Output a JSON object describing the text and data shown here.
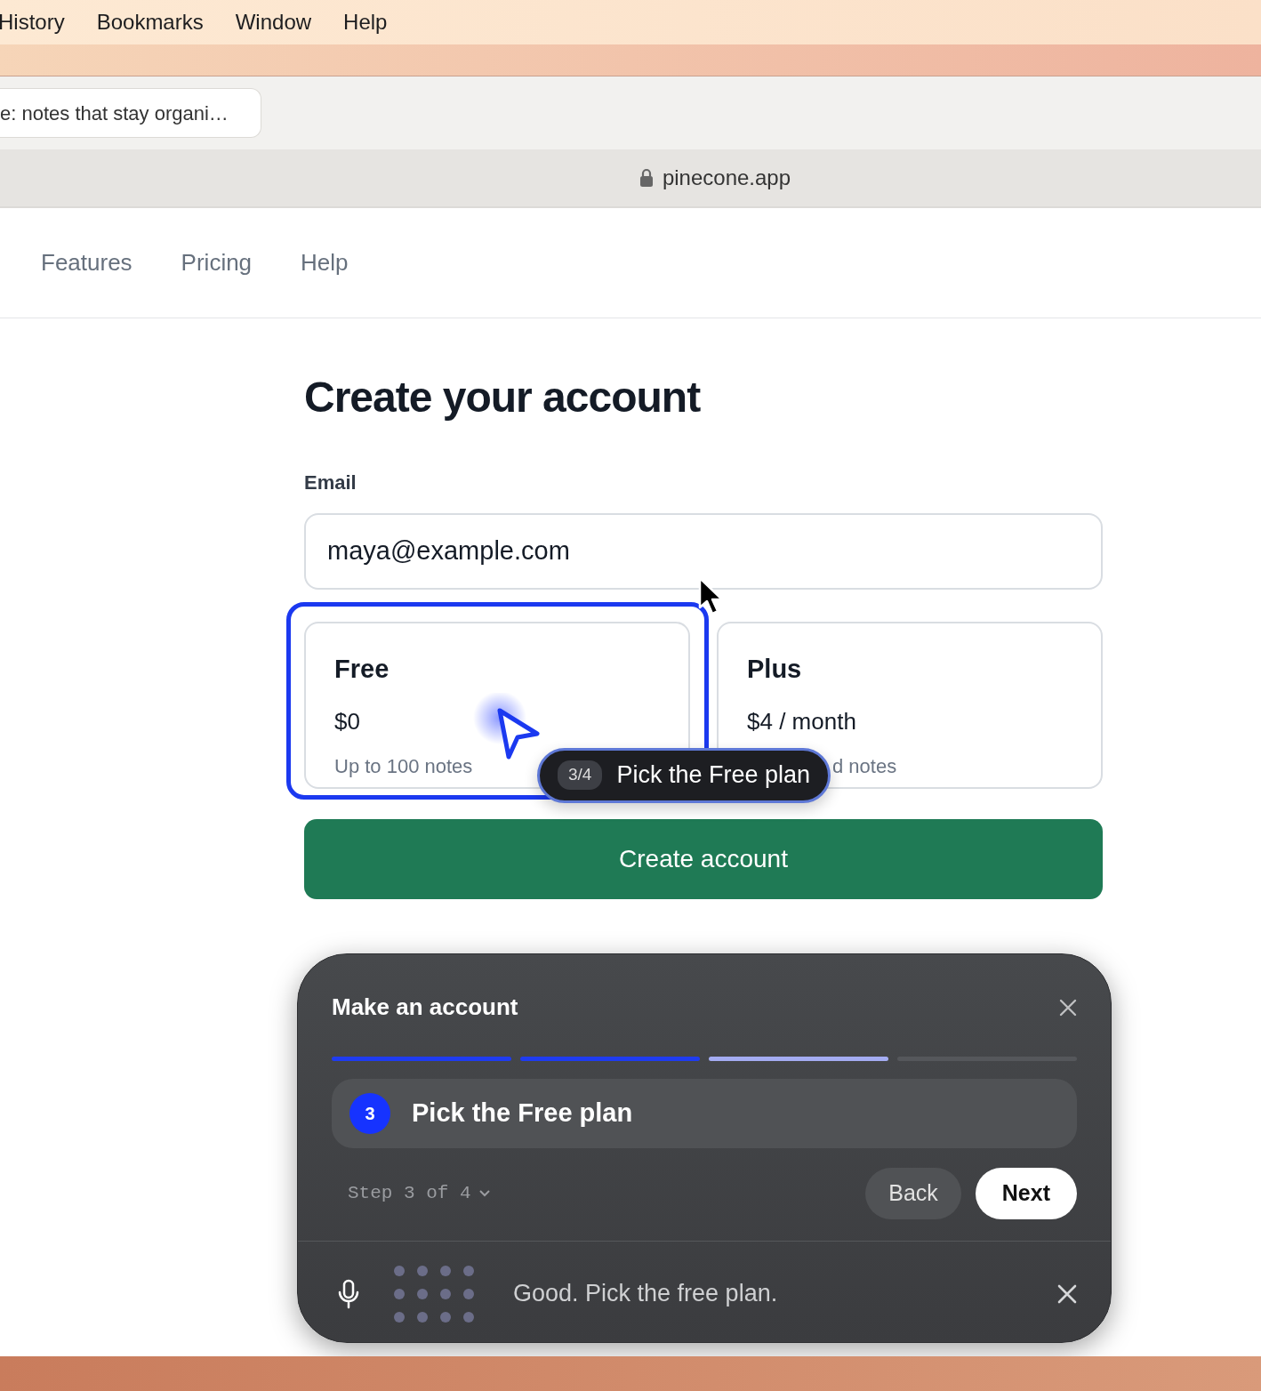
{
  "menu_bar": {
    "items": [
      "History",
      "Bookmarks",
      "Window",
      "Help"
    ]
  },
  "browser": {
    "tab_title": "e: notes that stay organi…",
    "address": "pinecone.app",
    "secure": true
  },
  "site_nav": {
    "links": [
      "Features",
      "Pricing",
      "Help"
    ]
  },
  "form": {
    "title": "Create your account",
    "email_label": "Email",
    "email_value": "maya@example.com",
    "plans": [
      {
        "name": "Free",
        "price": "$0",
        "description": "Up to 100 notes",
        "highlighted": true
      },
      {
        "name": "Plus",
        "price": "$4 / month",
        "description": "d notes",
        "highlighted": false
      }
    ],
    "submit": "Create account"
  },
  "tour_tooltip": {
    "counter": "3/4",
    "text": "Pick the Free plan"
  },
  "tour_panel": {
    "title": "Make an account",
    "segments": [
      {
        "completed": true,
        "current": false
      },
      {
        "completed": true,
        "current": false
      },
      {
        "completed": false,
        "current": true
      },
      {
        "completed": false,
        "current": false
      }
    ],
    "step_number": "3",
    "step_text": "Pick the Free plan",
    "step_label": "Step 3 of 4",
    "back": "Back",
    "next": "Next",
    "transcript": "Good. Pick the free plan.",
    "listening": true
  }
}
